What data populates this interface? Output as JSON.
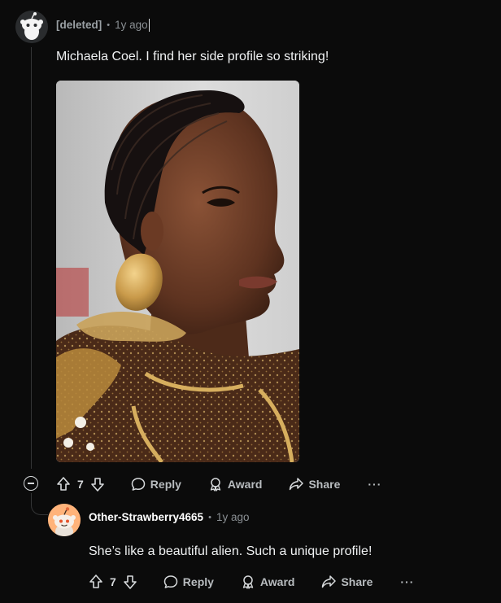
{
  "comments": [
    {
      "author": "[deleted]",
      "separator": "•",
      "time": "1y ago",
      "body": "Michaela Coel. I find her side profile so striking!",
      "votes": "7",
      "actions": {
        "reply": "Reply",
        "award": "Award",
        "share": "Share",
        "more": "···"
      }
    },
    {
      "author": "Other-Strawberry4665",
      "separator": "•",
      "time": "1y ago",
      "body": "She’s like a beautiful alien. Such a unique profile!",
      "votes": "7",
      "actions": {
        "reply": "Reply",
        "award": "Award",
        "share": "Share",
        "more": "···"
      }
    }
  ],
  "colors": {
    "background": "#0b0b0b",
    "text": "#d7dadc",
    "muted": "#8a8f93",
    "reply_avatar": "#ffb37a"
  },
  "icons": [
    "snoo-avatar-icon",
    "upvote-icon",
    "downvote-icon",
    "comment-icon",
    "award-icon",
    "share-icon",
    "collapse-icon"
  ]
}
